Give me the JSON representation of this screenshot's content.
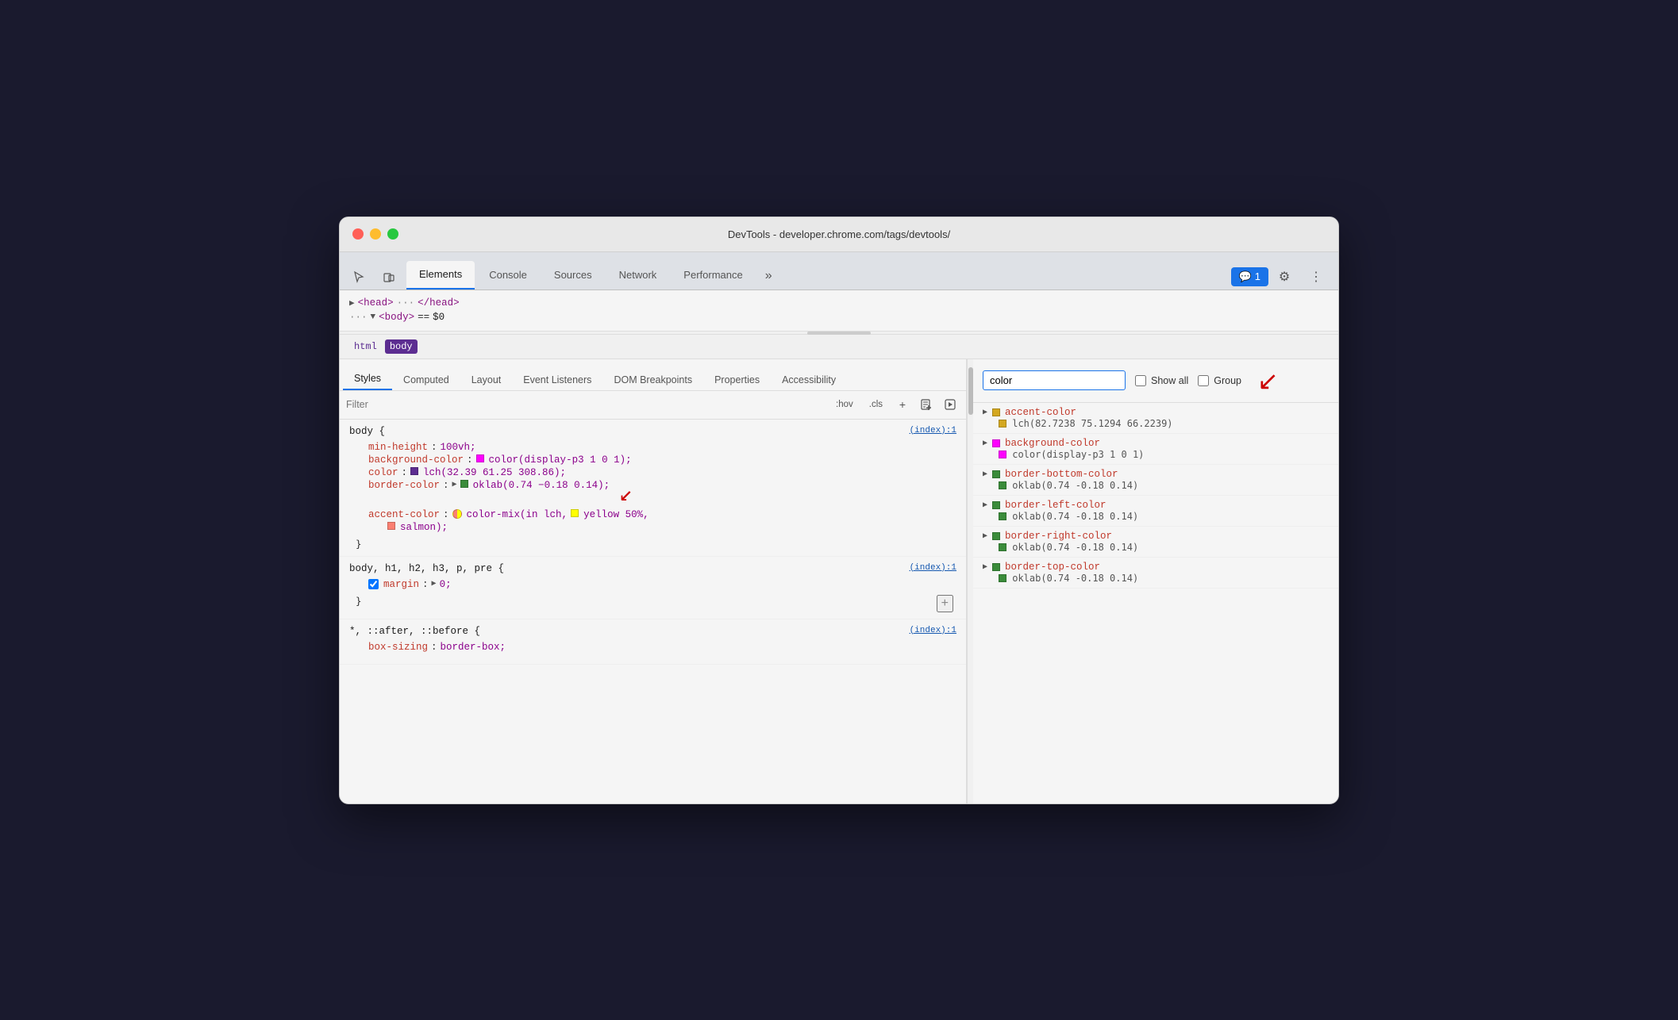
{
  "window": {
    "title": "DevTools - developer.chrome.com/tags/devtools/"
  },
  "devtools_tabs": {
    "items": [
      "Elements",
      "Console",
      "Sources",
      "Network",
      "Performance"
    ],
    "active": "Elements",
    "more_label": "»",
    "badge_label": "💬 1"
  },
  "dom_panel": {
    "line1": "▶ <head> ··· </head>",
    "line2": "··· ▼ <body> == $0"
  },
  "breadcrumb": {
    "items": [
      "html",
      "body"
    ]
  },
  "panel_tabs": {
    "items": [
      "Styles",
      "Computed",
      "Layout",
      "Event Listeners",
      "DOM Breakpoints",
      "Properties",
      "Accessibility"
    ],
    "active": "Styles"
  },
  "filter": {
    "placeholder": "Filter",
    "hov_label": ":hov",
    "cls_label": ".cls"
  },
  "css_rules": [
    {
      "selector": "body {",
      "source": "(index):1",
      "props": [
        {
          "name": "min-height",
          "colon": ":",
          "value": "100vh;",
          "swatch": null,
          "checked": null,
          "triangle": null
        },
        {
          "name": "background-color",
          "colon": ":",
          "value": "color(display-p3 1 0 1);",
          "swatch": "#ff00ff",
          "checked": null,
          "triangle": null
        },
        {
          "name": "color",
          "colon": ":",
          "value": "lch(32.39 61.25 308.86);",
          "swatch": "#5c2d91",
          "checked": null,
          "triangle": null
        },
        {
          "name": "border-color",
          "colon": ":",
          "value": "oklab(0.74 -0.18 0.14);",
          "swatch": "#3a8c3a",
          "checked": null,
          "triangle": "▶"
        },
        {
          "name": "accent-color",
          "colon": ":",
          "value": "color-mix(in lch,",
          "swatch": "mix",
          "checked": null,
          "triangle": null,
          "extra": "yellow 50%, salmon);"
        }
      ],
      "close": "}"
    },
    {
      "selector": "body, h1, h2, h3, p, pre {",
      "source": "(index):1",
      "props": [
        {
          "name": "margin",
          "colon": ":",
          "value": "▶ 0;",
          "swatch": null,
          "checked": true,
          "triangle": null
        }
      ],
      "close": "}",
      "has_plus": true
    },
    {
      "selector": "*, ::after, ::before {",
      "source": "(index):1",
      "props": [
        {
          "name": "box-sizing",
          "colon": ":",
          "value": "border-box;",
          "swatch": null,
          "checked": null,
          "triangle": null
        }
      ],
      "close": null
    }
  ],
  "computed_panel": {
    "search_placeholder": "color",
    "show_all_label": "Show all",
    "group_label": "Group",
    "items": [
      {
        "prop": "accent-color",
        "swatch": "#d4a820",
        "value": "lch(82.7238 75.1294 66.2239)"
      },
      {
        "prop": "background-color",
        "swatch": "#ff00ff",
        "value": "color(display-p3 1 0 1)"
      },
      {
        "prop": "border-bottom-color",
        "swatch": "#3a8c3a",
        "value": "oklab(0.74 -0.18 0.14)"
      },
      {
        "prop": "border-left-color",
        "swatch": "#3a8c3a",
        "value": "oklab(0.74 -0.18 0.14)"
      },
      {
        "prop": "border-right-color",
        "swatch": "#3a8c3a",
        "value": "oklab(0.74 -0.18 0.14)"
      },
      {
        "prop": "border-top-color",
        "swatch": "#3a8c3a",
        "value": "oklab(0.74 -0.18 0.14)"
      }
    ]
  },
  "icons": {
    "cursor": "⬚",
    "layers": "⧉",
    "gear": "⚙",
    "more_vert": "⋮",
    "plus": "+",
    "new_rule": "📋",
    "play": "▶"
  }
}
